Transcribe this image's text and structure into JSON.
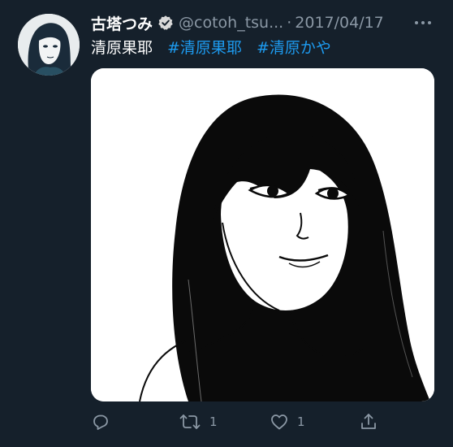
{
  "user": {
    "display_name": "古塔つみ",
    "handle": "@cotoh_tsu...",
    "date": "2017/04/17",
    "separator": "·",
    "verified_icon": "verified-badge-icon",
    "avatar_icon": "avatar-portrait"
  },
  "tweet": {
    "text": "清原果耶",
    "hashtags": [
      "#清原果耶",
      "#清原かや"
    ],
    "media_description_icon": "portrait-illustration"
  },
  "actions": {
    "reply_icon": "reply-icon",
    "retweet_icon": "retweet-icon",
    "retweet_count": "1",
    "like_icon": "heart-icon",
    "like_count": "1",
    "share_icon": "share-icon"
  },
  "colors": {
    "background": "#15202b",
    "text": "#ffffff",
    "secondary": "#8b98a5",
    "link": "#1d9bf0"
  }
}
